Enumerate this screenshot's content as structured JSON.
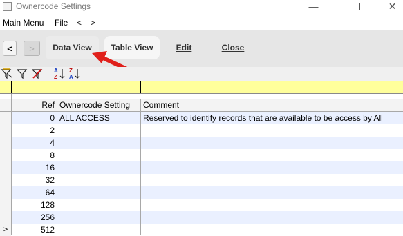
{
  "window": {
    "title": "Ownercode Settings",
    "controls": {
      "minimize": "—",
      "maximize": "",
      "close": "✕"
    }
  },
  "menu": {
    "items": [
      "Main Menu",
      "File",
      "<",
      ">"
    ]
  },
  "toolbar": {
    "back_label": "<",
    "forward_label": ">",
    "data_view_label": "Data View",
    "table_view_label": "Table View",
    "edit_label": "Edit",
    "close_label": "Close"
  },
  "annotation": {
    "arrow_color": "#e0201b"
  },
  "filterbar": {
    "icons": [
      "filter-apply-icon",
      "filter-icon",
      "filter-clear-icon",
      "sort-ascending-icon",
      "sort-descending-icon"
    ]
  },
  "grid": {
    "headers": {
      "ref": "Ref",
      "setting": "Ownercode Setting",
      "comment": "Comment"
    },
    "rows": [
      {
        "indicator": "",
        "ref": "0",
        "setting": "ALL ACCESS",
        "comment": "Reserved to identify records that are available to be access by All"
      },
      {
        "indicator": "",
        "ref": "2",
        "setting": "",
        "comment": ""
      },
      {
        "indicator": "",
        "ref": "4",
        "setting": "",
        "comment": ""
      },
      {
        "indicator": "",
        "ref": "8",
        "setting": "",
        "comment": ""
      },
      {
        "indicator": "",
        "ref": "16",
        "setting": "",
        "comment": ""
      },
      {
        "indicator": "",
        "ref": "32",
        "setting": "",
        "comment": ""
      },
      {
        "indicator": "",
        "ref": "64",
        "setting": "",
        "comment": ""
      },
      {
        "indicator": "",
        "ref": "128",
        "setting": "",
        "comment": ""
      },
      {
        "indicator": "",
        "ref": "256",
        "setting": "",
        "comment": ""
      },
      {
        "indicator": ">",
        "ref": "512",
        "setting": "",
        "comment": ""
      }
    ],
    "filter_row_color": "#ffff9b",
    "alt_row_color": "#eaf0ff"
  }
}
